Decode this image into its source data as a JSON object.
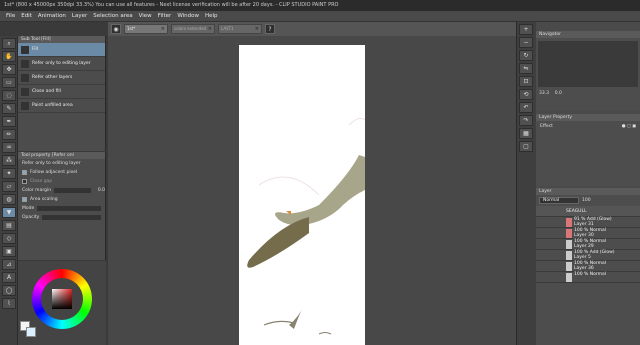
{
  "titlebar": {
    "text": "1st* (800 x 45000px 350dpi 33.3%)   You can use all features - Next license verification will be after 20 days. - CLIP STUDIO PAINT PRO"
  },
  "menu": [
    "File",
    "Edit",
    "Animation",
    "Layer",
    "Selection area",
    "View",
    "Filter",
    "Window",
    "Help"
  ],
  "doc_tabs": [
    "1st*",
    "colors extended",
    "LAST1"
  ],
  "subtool": {
    "header": "Sub Tool [Fill]",
    "items": [
      {
        "label": "Fill"
      },
      {
        "label": "Refer only to editing layer"
      },
      {
        "label": "Refer other layers"
      },
      {
        "label": "Close and fill"
      },
      {
        "label": "Paint unfilled area"
      }
    ]
  },
  "toolprop": {
    "header": "Tool property [Refer onl",
    "title": "Refer only to editing layer",
    "rows": [
      {
        "label": "Follow adjacent pixel",
        "checked": true
      },
      {
        "label": "Close gap",
        "checked": false
      },
      {
        "label": "Color margin",
        "value": "0.0"
      },
      {
        "label": "Area scaling",
        "checked": true
      },
      {
        "label": "Mode",
        "value": ""
      },
      {
        "label": "Opacity",
        "value": ""
      }
    ]
  },
  "navigator": {
    "header": "Navigator",
    "zoom": "33.3",
    "rotation": "0.0"
  },
  "layer_property": {
    "header": "Layer Property",
    "effect_label": "Effect"
  },
  "layers": {
    "header": "Layer",
    "blend_mode": "Normal",
    "opacity": "100",
    "items": [
      {
        "name": "SEAGULL",
        "folder": true
      },
      {
        "name": "91 % Add (Glow)",
        "sub": "Layer 31",
        "hl": true
      },
      {
        "name": "100 % Normal",
        "sub": "Layer 30",
        "hl": true
      },
      {
        "name": "100 % Normal",
        "sub": "Layer 29"
      },
      {
        "name": "100 % Add (Glow)",
        "sub": "Layer 5"
      },
      {
        "name": "100 % Normal",
        "sub": "Layer 36"
      },
      {
        "name": "100 % Normal",
        "sub": ""
      }
    ]
  },
  "colors": {
    "main": "#e02424",
    "fg": "#f4f4f4",
    "bg": "#d8f0ff",
    "selected_tool": "#6a8aa6"
  },
  "icons": {
    "left_tools": [
      "magnifier-icon",
      "hand-icon",
      "move-icon",
      "select-icon",
      "lasso-icon",
      "eyedropper-icon",
      "pen-icon",
      "pencil-icon",
      "brush-icon",
      "airbrush-icon",
      "decoration-icon",
      "eraser-icon",
      "blend-icon",
      "fill-icon",
      "gradient-icon",
      "figure-icon",
      "frame-icon",
      "ruler-icon",
      "text-icon",
      "balloon-icon",
      "line-correct-icon"
    ],
    "right_tools": [
      "zoom-in-icon",
      "zoom-out-icon",
      "rotate-icon",
      "flip-icon",
      "fit-icon",
      "reset-icon",
      "undo-icon",
      "redo-icon",
      "layer-icon",
      "page-icon"
    ]
  }
}
